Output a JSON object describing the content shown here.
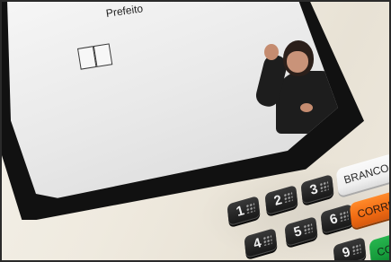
{
  "screen": {
    "title": "Prefeito",
    "digit_boxes": 2
  },
  "keypad": {
    "number_keys": [
      {
        "label": "1"
      },
      {
        "label": "2"
      },
      {
        "label": "3"
      },
      {
        "label": "4"
      },
      {
        "label": "5"
      },
      {
        "label": "6"
      },
      {
        "label": "9"
      }
    ],
    "branco_label": "BRANCO",
    "corrige_label": "CORRIG",
    "confirma_label": "CO"
  },
  "colors": {
    "body": "#efeadf",
    "bezel": "#111111",
    "screen": "#e6e6e6",
    "key_dark": "#262626",
    "branco": "#f5f5f5",
    "corrige": "#f06a12",
    "confirma": "#159a3a"
  }
}
